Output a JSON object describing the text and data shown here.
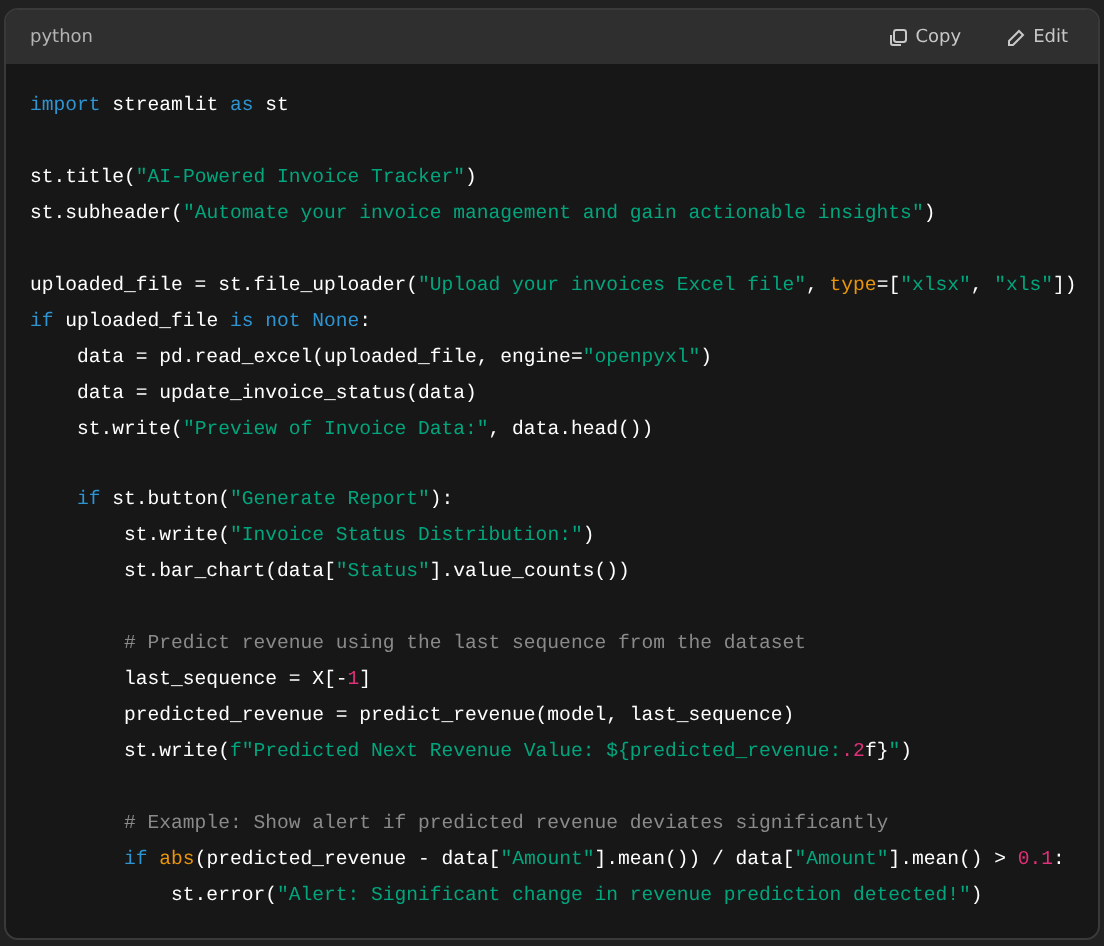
{
  "code_block": {
    "language": "python",
    "actions": [
      {
        "kind": "copy",
        "label": "Copy"
      },
      {
        "kind": "edit",
        "label": "Edit"
      }
    ],
    "blocks": [
      {
        "lines": [
          [
            {
              "text": "import",
              "kind": "keyword"
            },
            {
              "text": " streamlit ",
              "kind": "plain"
            },
            {
              "text": "as",
              "kind": "keyword"
            },
            {
              "text": " st",
              "kind": "plain"
            }
          ]
        ]
      },
      {
        "lines": [
          [
            {
              "text": "st.title(",
              "kind": "plain"
            },
            {
              "text": "\"AI-Powered Invoice Tracker\"",
              "kind": "string"
            },
            {
              "text": ")",
              "kind": "plain"
            }
          ],
          [
            {
              "text": "st.subheader(",
              "kind": "plain"
            },
            {
              "text": "\"Automate your invoice management and gain actionable insights\"",
              "kind": "string"
            },
            {
              "text": ")",
              "kind": "plain"
            }
          ]
        ]
      },
      {
        "lines": [
          [
            {
              "text": "uploaded_file = st.file_uploader(",
              "kind": "plain"
            },
            {
              "text": "\"Upload your invoices Excel file\"",
              "kind": "string"
            },
            {
              "text": ", ",
              "kind": "plain"
            },
            {
              "text": "type",
              "kind": "builtin"
            },
            {
              "text": "=[",
              "kind": "plain"
            },
            {
              "text": "\"xlsx\"",
              "kind": "string"
            },
            {
              "text": ", ",
              "kind": "plain"
            },
            {
              "text": "\"xls\"",
              "kind": "string"
            },
            {
              "text": "])",
              "kind": "plain"
            }
          ],
          [
            {
              "text": "if",
              "kind": "keyword"
            },
            {
              "text": " uploaded_file ",
              "kind": "plain"
            },
            {
              "text": "is not None",
              "kind": "keyword"
            },
            {
              "text": ":",
              "kind": "plain"
            }
          ],
          [
            {
              "text": "    data = pd.read_excel(uploaded_file, engine=",
              "kind": "plain"
            },
            {
              "text": "\"openpyxl\"",
              "kind": "string"
            },
            {
              "text": ")",
              "kind": "plain"
            }
          ],
          [
            {
              "text": "    data = update_invoice_status(data)",
              "kind": "plain"
            }
          ],
          [
            {
              "text": "    st.write(",
              "kind": "plain"
            },
            {
              "text": "\"Preview of Invoice Data:\"",
              "kind": "string"
            },
            {
              "text": ", data.head())",
              "kind": "plain"
            }
          ]
        ]
      },
      {
        "lines": [
          [
            {
              "text": "    if",
              "kind": "keyword"
            },
            {
              "text": " st.button(",
              "kind": "plain"
            },
            {
              "text": "\"Generate Report\"",
              "kind": "string"
            },
            {
              "text": "):",
              "kind": "plain"
            }
          ],
          [
            {
              "text": "        st.write(",
              "kind": "plain"
            },
            {
              "text": "\"Invoice Status Distribution:\"",
              "kind": "string"
            },
            {
              "text": ")",
              "kind": "plain"
            }
          ],
          [
            {
              "text": "        st.bar_chart(data[",
              "kind": "plain"
            },
            {
              "text": "\"Status\"",
              "kind": "string"
            },
            {
              "text": "].value_counts())",
              "kind": "plain"
            }
          ]
        ]
      },
      {
        "lines": [
          [
            {
              "text": "        # Predict revenue using the last sequence from the dataset",
              "kind": "comment"
            }
          ],
          [
            {
              "text": "        last_sequence = X[-",
              "kind": "plain"
            },
            {
              "text": "1",
              "kind": "number"
            },
            {
              "text": "]",
              "kind": "plain"
            }
          ],
          [
            {
              "text": "        predicted_revenue = predict_revenue(model, last_sequence)",
              "kind": "plain"
            }
          ],
          [
            {
              "text": "        st.write(",
              "kind": "plain"
            },
            {
              "text": "f\"Predicted Next Revenue Value: ${predicted_revenue:",
              "kind": "string"
            },
            {
              "text": ".2",
              "kind": "number"
            },
            {
              "text": "f}",
              "kind": "plain"
            },
            {
              "text": "\"",
              "kind": "string"
            },
            {
              "text": ")",
              "kind": "plain"
            }
          ]
        ]
      },
      {
        "lines": [
          [
            {
              "text": "        # Example: Show alert if predicted revenue deviates significantly",
              "kind": "comment"
            }
          ],
          [
            {
              "text": "        if",
              "kind": "keyword"
            },
            {
              "text": " abs",
              "kind": "builtin"
            },
            {
              "text": "(predicted_revenue - data[",
              "kind": "plain"
            },
            {
              "text": "\"Amount\"",
              "kind": "string"
            },
            {
              "text": "].mean()) / data[",
              "kind": "plain"
            },
            {
              "text": "\"Amount\"",
              "kind": "string"
            },
            {
              "text": "].mean() > ",
              "kind": "plain"
            },
            {
              "text": "0.1",
              "kind": "number"
            },
            {
              "text": ":",
              "kind": "plain"
            }
          ],
          [
            {
              "text": "            st.error(",
              "kind": "plain"
            },
            {
              "text": "\"Alert: Significant change in revenue prediction detected!\"",
              "kind": "string"
            },
            {
              "text": ")",
              "kind": "plain"
            }
          ]
        ]
      }
    ]
  }
}
